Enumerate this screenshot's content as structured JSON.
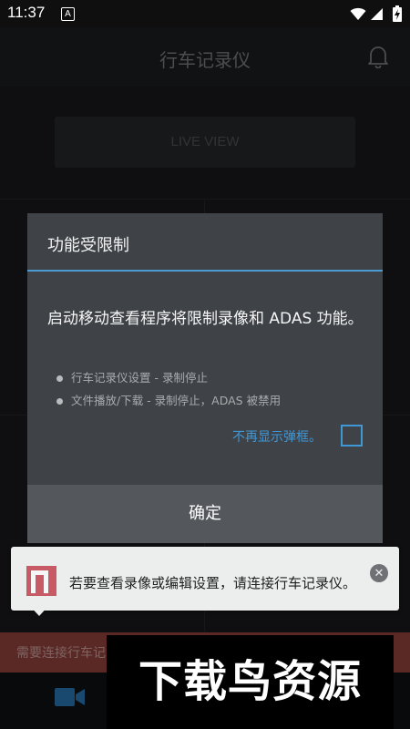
{
  "status_bar": {
    "time": "11:37",
    "notification_icon_label": "A",
    "icons": [
      "wifi-icon",
      "signal-icon",
      "battery-charging-icon"
    ]
  },
  "app_bar": {
    "title": "行车记录仪",
    "icon": "bell-icon"
  },
  "background": {
    "live_view_label": "LIVE VIEW",
    "banner_text": "需要连接行车记",
    "bottom_icon": "video-camera-icon"
  },
  "dialog": {
    "title": "功能受限制",
    "message": "启动移动查看程序将限制录像和 ADAS 功能。",
    "bullets": [
      "行车记录仪设置 - 录制停止",
      "文件播放/下载 - 录制停止，ADAS 被禁用"
    ],
    "dont_show_label": "不再显示弹框。",
    "dont_show_checked": false,
    "ok_label": "确定"
  },
  "toast": {
    "text": "若要查看录像或编辑设置，请连接行车记录仪。",
    "close_icon": "close-icon"
  },
  "watermark": {
    "text": "下载鸟资源"
  },
  "colors": {
    "accent": "#4a9bd2",
    "dialog_bg": "#3f4348",
    "ok_button_bg": "#54585d",
    "banner_bg": "#a44944",
    "toast_bg": "#eceded"
  }
}
